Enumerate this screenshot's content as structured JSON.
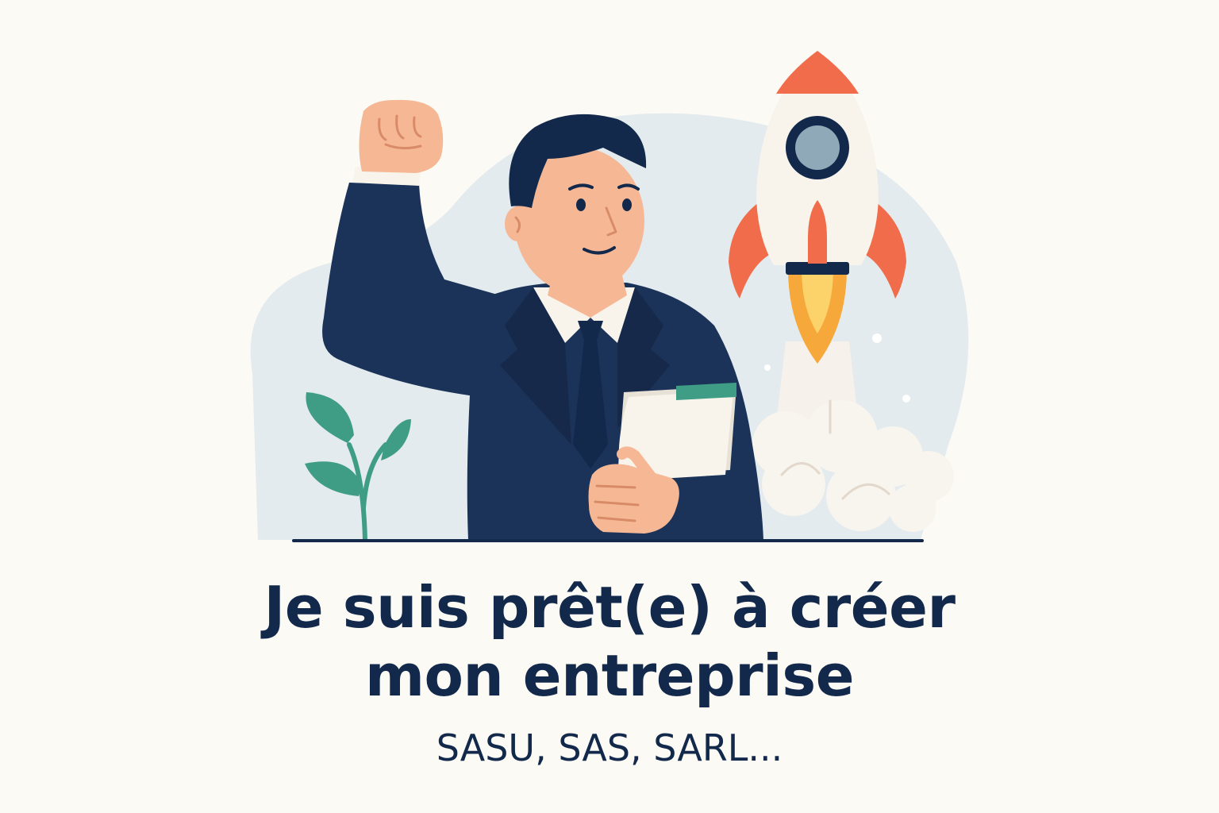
{
  "headline": {
    "line1": "Je suis prêt(e) à créer",
    "line2": "mon entreprise"
  },
  "subtitle": "SASU, SAS, SARL...",
  "colors": {
    "background": "#fcfaf5",
    "navy": "#13294b",
    "suit": "#1b3358",
    "skin": "#f6b894",
    "blob": "#e3ebee",
    "leaf": "#3f9d86",
    "rocket_body": "#f8f4ec",
    "rocket_accent": "#f06c4a",
    "flame_outer": "#f7a83a",
    "flame_inner": "#fcd36a"
  },
  "icons": {
    "rocket": "rocket-icon",
    "plant": "plant-icon",
    "person": "businessman-figure",
    "document": "document-icon"
  }
}
